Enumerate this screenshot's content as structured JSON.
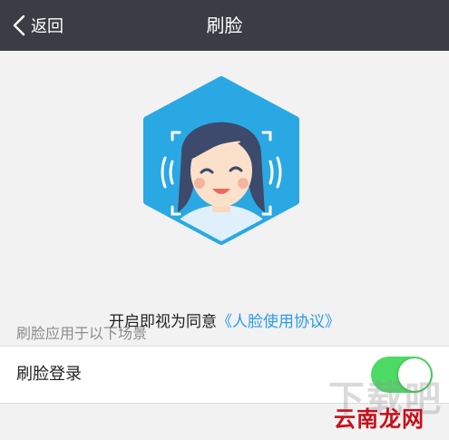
{
  "navbar": {
    "back_label": "返回",
    "title": "刷脸"
  },
  "hero": {
    "agree_text": "开启即视为同意",
    "agree_link": "《人脸使用协议》"
  },
  "section": {
    "label": "刷脸应用于以下场景"
  },
  "settings": {
    "face_login_label": "刷脸登录",
    "face_login_enabled": true
  },
  "watermark": {
    "text": "云南龙网"
  },
  "colors": {
    "navbar_bg": "#3a3d43",
    "hex_blue": "#2aa8e4",
    "link_blue": "#2b9be8",
    "toggle_on": "#4cd964",
    "watermark_red": "#c8101a"
  },
  "icons": {
    "back": "chevron-left-icon",
    "avatar": "face-scan-avatar-icon"
  }
}
